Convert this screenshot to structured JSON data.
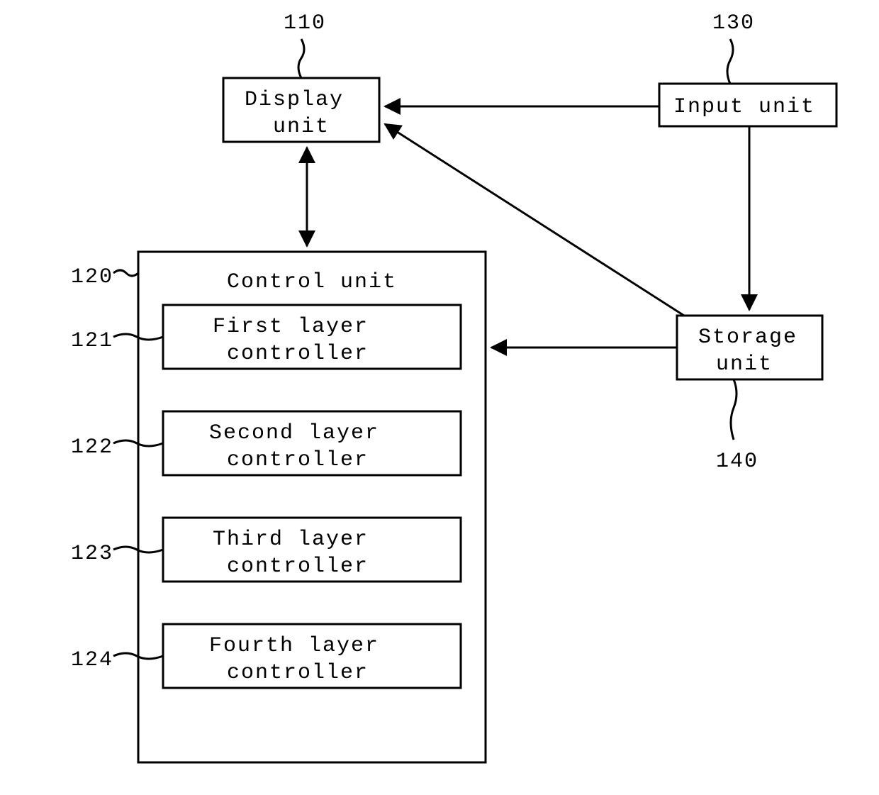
{
  "blocks": {
    "display": {
      "ref": "110",
      "line1": "Display",
      "line2": "unit"
    },
    "input": {
      "ref": "130",
      "line1": "Input unit"
    },
    "storage": {
      "ref": "140",
      "line1": "Storage",
      "line2": "unit"
    },
    "control": {
      "ref": "120",
      "title": "Control unit"
    },
    "layer1": {
      "ref": "121",
      "line1": "First layer",
      "line2": "controller"
    },
    "layer2": {
      "ref": "122",
      "line1": "Second layer",
      "line2": "controller"
    },
    "layer3": {
      "ref": "123",
      "line1": "Third layer",
      "line2": "controller"
    },
    "layer4": {
      "ref": "124",
      "line1": "Fourth layer",
      "line2": "controller"
    }
  }
}
